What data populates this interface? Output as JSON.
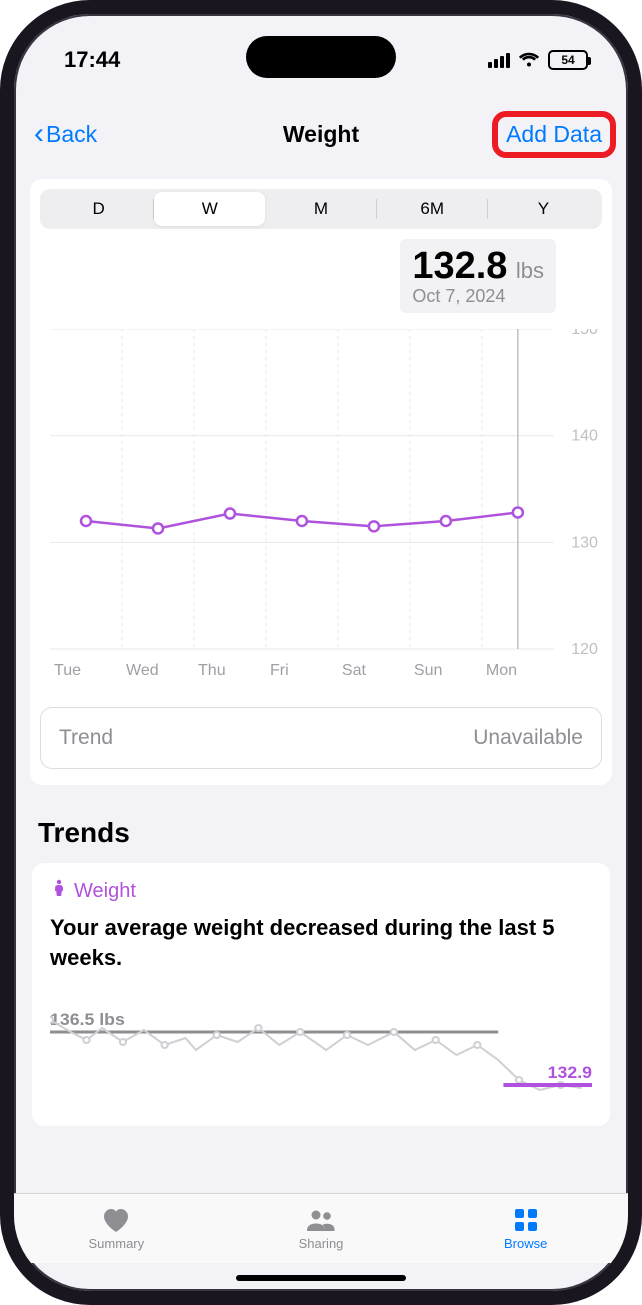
{
  "status": {
    "time": "17:44",
    "battery": "54"
  },
  "nav": {
    "back": "Back",
    "title": "Weight",
    "add": "Add Data"
  },
  "segments": [
    "D",
    "W",
    "M",
    "6M",
    "Y"
  ],
  "segment_selected_index": 1,
  "reading": {
    "value": "132.8",
    "unit": "lbs",
    "date": "Oct 7, 2024"
  },
  "chart_data": {
    "type": "line",
    "categories": [
      "Tue",
      "Wed",
      "Thu",
      "Fri",
      "Sat",
      "Sun",
      "Mon"
    ],
    "values": [
      132.0,
      131.3,
      132.7,
      132.0,
      131.5,
      132.0,
      132.8
    ],
    "ylim": [
      120,
      150
    ],
    "ylabel": "",
    "xlabel": "",
    "y_ticks": [
      120,
      130,
      140,
      150
    ]
  },
  "trend_row": {
    "label": "Trend",
    "value": "Unavailable"
  },
  "trends_section": {
    "title": "Trends",
    "card": {
      "title": "Weight",
      "body": "Your average weight decreased during the last 5 weeks.",
      "avg_label": "136.5 lbs",
      "current_label": "132.9"
    }
  },
  "tabs": [
    {
      "label": "Summary",
      "active": false
    },
    {
      "label": "Sharing",
      "active": false
    },
    {
      "label": "Browse",
      "active": true
    }
  ],
  "colors": {
    "accent": "#007aff",
    "purple": "#af52de",
    "highlight": "#ed1c24"
  }
}
